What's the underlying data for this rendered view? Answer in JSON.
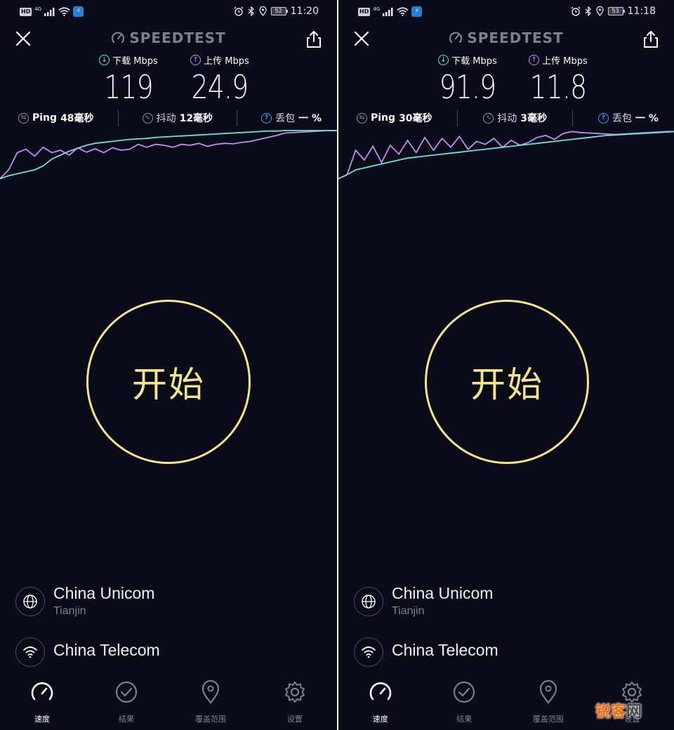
{
  "screens": [
    {
      "status": {
        "hd": "HD",
        "network": "4G",
        "battery": "52",
        "time": "11:20"
      },
      "brand": "SPEEDTEST",
      "download": {
        "label": "下载 Mbps",
        "value": "119"
      },
      "upload": {
        "label": "上传 Mbps",
        "value": "24.9"
      },
      "ping": {
        "label": "Ping",
        "value": "48毫秒"
      },
      "jitter": {
        "label": "抖动",
        "value": "12毫秒"
      },
      "loss": {
        "label": "丢包",
        "value": "一 %"
      },
      "start_label": "开始",
      "isp": {
        "name": "China Unicom",
        "location": "Tianjin"
      },
      "host": {
        "name": "China Telecom"
      },
      "graph": {
        "download": [
          0.02,
          0.2,
          0.55,
          0.62,
          0.48,
          0.66,
          0.55,
          0.6,
          0.5,
          0.65,
          0.56,
          0.63,
          0.55,
          0.65,
          0.6,
          0.62,
          0.72,
          0.66,
          0.72,
          0.7,
          0.66,
          0.72,
          0.7,
          0.74,
          0.68,
          0.72,
          0.74,
          0.73,
          0.76,
          0.78,
          0.82,
          0.86,
          0.9,
          0.95,
          0.96,
          0.97,
          0.98,
          0.99,
          1.0,
          1.0
        ],
        "upload": [
          0.02,
          0.08,
          0.12,
          0.16,
          0.2,
          0.28,
          0.42,
          0.5,
          0.58,
          0.64,
          0.7,
          0.74,
          0.76,
          0.78,
          0.8,
          0.82,
          0.83,
          0.84,
          0.86,
          0.87,
          0.88,
          0.89,
          0.9,
          0.91,
          0.92,
          0.93,
          0.94,
          0.95,
          0.96,
          0.97,
          0.98,
          0.99,
          0.99,
          1.0,
          1.0,
          1.0,
          1.0,
          1.0,
          1.0,
          1.0
        ]
      }
    },
    {
      "status": {
        "hd": "HD",
        "network": "4G",
        "battery": "53",
        "time": "11:18"
      },
      "brand": "SPEEDTEST",
      "download": {
        "label": "下载 Mbps",
        "value": "91.9"
      },
      "upload": {
        "label": "上传 Mbps",
        "value": "11.8"
      },
      "ping": {
        "label": "Ping",
        "value": "30毫秒"
      },
      "jitter": {
        "label": "抖动",
        "value": "3毫秒"
      },
      "loss": {
        "label": "丢包",
        "value": "一 %"
      },
      "start_label": "开始",
      "isp": {
        "name": "China Unicom",
        "location": "Tianjin"
      },
      "host": {
        "name": "China Telecom"
      },
      "graph": {
        "download": [
          0.02,
          0.1,
          0.6,
          0.4,
          0.68,
          0.35,
          0.7,
          0.52,
          0.8,
          0.55,
          0.86,
          0.6,
          0.84,
          0.66,
          0.88,
          0.62,
          0.78,
          0.72,
          0.84,
          0.66,
          0.8,
          0.7,
          0.76,
          0.86,
          0.9,
          0.82,
          0.94,
          0.98,
          0.96,
          0.95,
          0.94,
          0.93,
          0.92,
          0.93,
          0.94,
          0.95,
          0.96,
          0.97,
          0.98,
          0.98
        ],
        "upload": [
          0.02,
          0.1,
          0.2,
          0.24,
          0.28,
          0.32,
          0.36,
          0.4,
          0.44,
          0.46,
          0.48,
          0.5,
          0.52,
          0.54,
          0.56,
          0.58,
          0.6,
          0.62,
          0.64,
          0.66,
          0.68,
          0.7,
          0.72,
          0.74,
          0.76,
          0.78,
          0.8,
          0.82,
          0.84,
          0.86,
          0.88,
          0.9,
          0.91,
          0.92,
          0.93,
          0.94,
          0.95,
          0.96,
          0.97,
          0.98
        ]
      }
    }
  ],
  "nav": [
    {
      "label": "速度"
    },
    {
      "label": "结果"
    },
    {
      "label": "覆盖范围"
    },
    {
      "label": "设置"
    }
  ],
  "watermark": {
    "part1": "锐客",
    "part2": "网"
  },
  "colors": {
    "accent": "#f4e58a",
    "download": "#c48cf0",
    "upload": "#6fe3d3",
    "background": "#0b0c1a"
  }
}
